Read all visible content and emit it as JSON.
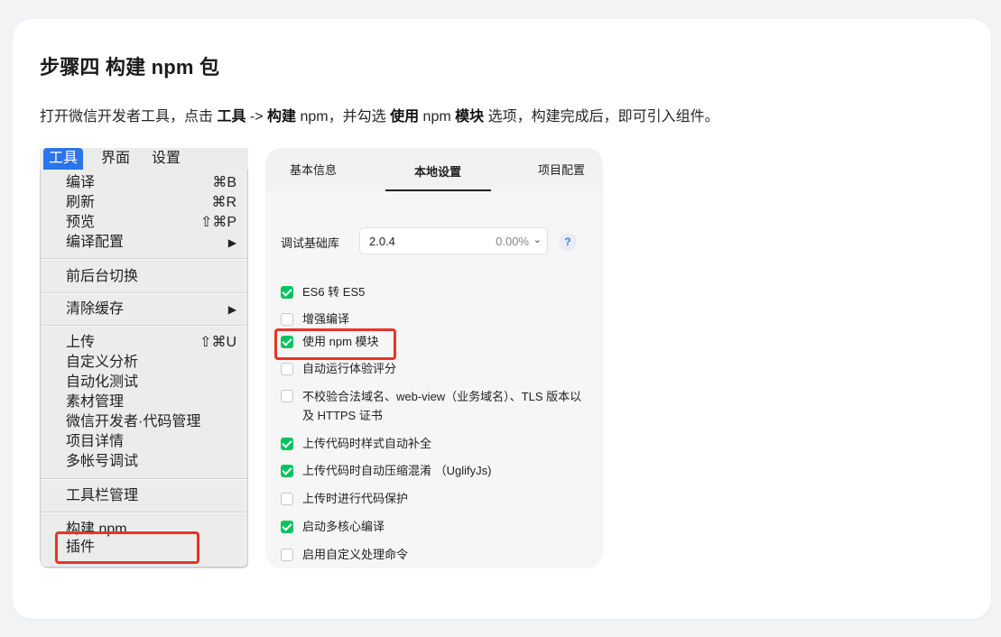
{
  "title": "步骤四 构建 npm 包",
  "desc": {
    "p1": "打开微信开发者工具，点击 ",
    "b1": "工具",
    "p2": " -> ",
    "b2": "构建",
    "p3": " npm，并勾选 ",
    "b3": "使用",
    "p4": " npm ",
    "b4": "模块",
    "p5": " 选项，构建完成后，即可引入组件。"
  },
  "menubar": {
    "items": [
      "工具",
      "界面",
      "设置"
    ]
  },
  "menu": {
    "group1": [
      {
        "label": "编译",
        "shortcut": "⌘B"
      },
      {
        "label": "刷新",
        "shortcut": "⌘R"
      },
      {
        "label": "预览",
        "shortcut": "⇧⌘P"
      },
      {
        "label": "编译配置",
        "shortcut": "▶"
      }
    ],
    "switch": "前后台切换",
    "clear": {
      "label": "清除缓存",
      "shortcut": "▶"
    },
    "group2": [
      {
        "label": "上传",
        "shortcut": "⇧⌘U"
      },
      {
        "label": "自定义分析",
        "shortcut": ""
      },
      {
        "label": "自动化测试",
        "shortcut": ""
      },
      {
        "label": "素材管理",
        "shortcut": ""
      },
      {
        "label": "微信开发者·代码管理",
        "shortcut": ""
      },
      {
        "label": "项目详情",
        "shortcut": ""
      },
      {
        "label": "多帐号调试",
        "shortcut": ""
      }
    ],
    "toolbar": "工具栏管理",
    "build_npm": "构建 npm",
    "plugin": "插件"
  },
  "settings": {
    "tabs": [
      "基本信息",
      "本地设置",
      "项目配置"
    ],
    "lib_label": "调试基础库",
    "lib_value": "2.0.4",
    "lib_pct": "0.00%",
    "help": "?",
    "options": [
      {
        "label": "ES6 转 ES5",
        "checked": true
      },
      {
        "label": "增强编译",
        "checked": false
      },
      {
        "label": "使用 npm 模块",
        "checked": true
      },
      {
        "label": "自动运行体验评分",
        "checked": false
      },
      {
        "label": "不校验合法域名、web-view（业务域名）、TLS 版本以及 HTTPS 证书",
        "checked": false
      },
      {
        "label": "上传代码时样式自动补全",
        "checked": true
      },
      {
        "label": "上传代码时自动压缩混淆 （UglifyJs)",
        "checked": true
      },
      {
        "label": "上传时进行代码保护",
        "checked": false
      },
      {
        "label": "启动多核心编译",
        "checked": true
      },
      {
        "label": "启用自定义处理命令",
        "checked": false
      }
    ]
  },
  "colors": {
    "highlight": "#e8332a",
    "checkbox_on": "#07c160",
    "menu_active": "#2d74e9"
  }
}
